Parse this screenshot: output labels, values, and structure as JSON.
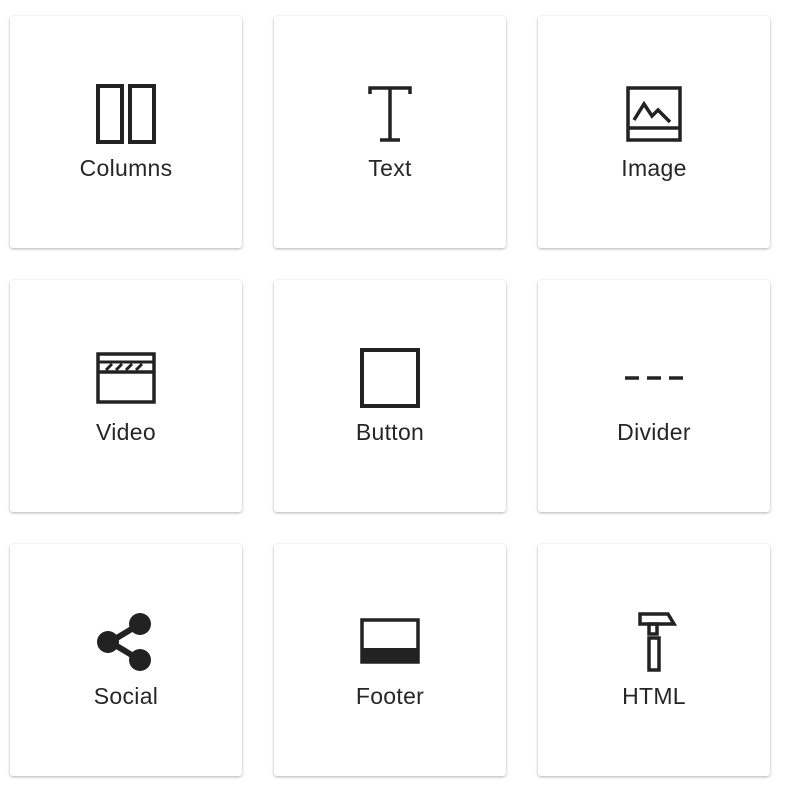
{
  "blocks": [
    {
      "label": "Columns",
      "icon": "columns-icon"
    },
    {
      "label": "Text",
      "icon": "text-icon"
    },
    {
      "label": "Image",
      "icon": "image-icon"
    },
    {
      "label": "Video",
      "icon": "video-icon"
    },
    {
      "label": "Button",
      "icon": "button-icon"
    },
    {
      "label": "Divider",
      "icon": "divider-icon"
    },
    {
      "label": "Social",
      "icon": "share-icon"
    },
    {
      "label": "Footer",
      "icon": "footer-icon"
    },
    {
      "label": "HTML",
      "icon": "hammer-icon"
    }
  ],
  "colors": {
    "icon": "#222222",
    "tile_background": "#ffffff",
    "label": "#262626"
  }
}
